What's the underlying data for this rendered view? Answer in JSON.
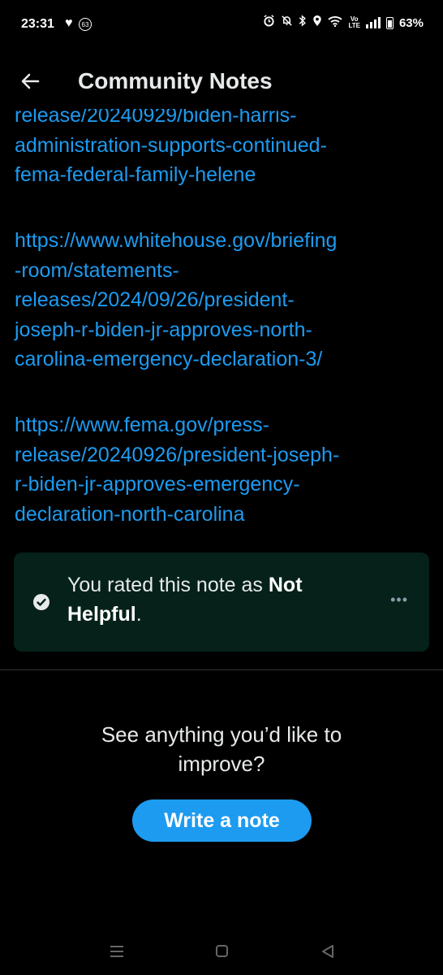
{
  "status_bar": {
    "time": "23:31",
    "notification_badge": "63",
    "battery": "63%",
    "volte_top": "Vo",
    "volte_bottom": "LTE",
    "battery_level": 0.63,
    "icons": [
      "heart-icon",
      "alarm-icon",
      "mute-icon",
      "bluetooth-icon",
      "location-icon",
      "wifi-icon",
      "signal-icon",
      "battery-icon"
    ]
  },
  "header": {
    "title": "Community Notes",
    "back_icon": "arrow-left-icon"
  },
  "links": [
    {
      "lines": [
        "release/20240929/biden-harris-",
        "administration-supports-continued-",
        "fema-federal-family-helene"
      ]
    },
    {
      "lines": [
        "https://www.whitehouse.gov/briefing",
        "-room/statements-",
        "releases/2024/09/26/president-",
        "joseph-r-biden-jr-approves-north-",
        "carolina-emergency-declaration-3/"
      ]
    },
    {
      "lines": [
        "https://www.fema.gov/press-",
        "release/20240926/president-joseph-",
        "r-biden-jr-approves-emergency-",
        "declaration-north-carolina"
      ]
    }
  ],
  "rating": {
    "prefix": "You rated this note as ",
    "value_line1": "Not",
    "value_line2": "Helpful",
    "suffix": ".",
    "more": "•••"
  },
  "cta": {
    "prompt_line1": "See anything you’d like to",
    "prompt_line2": "improve?",
    "button_label": "Write a note"
  },
  "colors": {
    "background": "#000000",
    "link": "#1d9bf0",
    "card": "#052119",
    "button": "#1d9bf0",
    "text": "#e7e9ea"
  }
}
